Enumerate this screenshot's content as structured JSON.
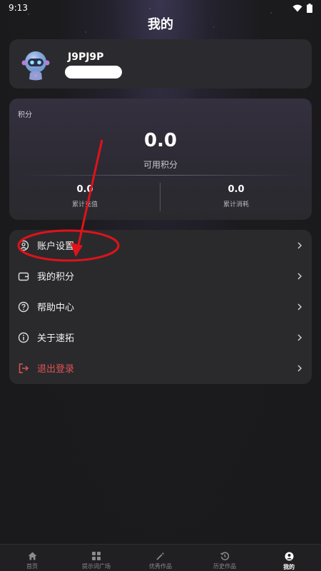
{
  "status_bar": {
    "time": "9:13"
  },
  "header": {
    "title": "我的"
  },
  "profile": {
    "username": "J9PJ9P"
  },
  "points": {
    "section_label": "积分",
    "available_value": "0.0",
    "available_label": "可用积分",
    "recharge_value": "0.0",
    "recharge_label": "累计充值",
    "consumed_value": "0.0",
    "consumed_label": "累计消耗"
  },
  "menu": {
    "items": [
      {
        "label": "账户设置",
        "icon": "user-gear-icon"
      },
      {
        "label": "我的积分",
        "icon": "wallet-icon"
      },
      {
        "label": "帮助中心",
        "icon": "help-circle-icon"
      },
      {
        "label": "关于速拓",
        "icon": "info-circle-icon"
      },
      {
        "label": "退出登录",
        "icon": "logout-icon"
      }
    ]
  },
  "tabbar": {
    "tabs": [
      {
        "label": "首页",
        "icon": "home-icon"
      },
      {
        "label": "提示词广场",
        "icon": "grid-icon"
      },
      {
        "label": "优秀作品",
        "icon": "magic-wand-icon"
      },
      {
        "label": "历史作品",
        "icon": "history-icon"
      },
      {
        "label": "我的",
        "icon": "profile-icon",
        "active": true
      }
    ]
  },
  "colors": {
    "accent_red": "#e05252",
    "annotation_red": "#e0121a",
    "card_bg": "#2a2a2e"
  }
}
